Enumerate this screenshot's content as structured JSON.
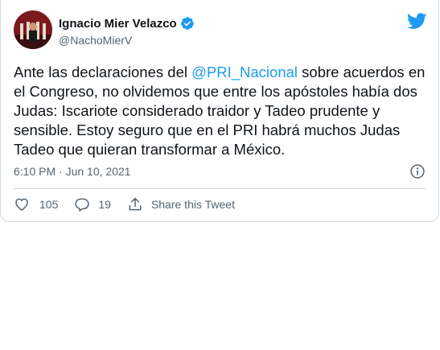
{
  "author": {
    "name": "Ignacio Mier Velazco",
    "handle": "@NachoMierV"
  },
  "tweet": {
    "text_before": "Ante las declaraciones del ",
    "mention": "@PRI_Nacional",
    "text_after": " sobre acuerdos en el Congreso, no olvidemos que entre los apóstoles había dos Judas: Iscariote considerado traidor y Tadeo prudente y sensible. Estoy seguro que en el PRI habrá muchos Judas Tadeo que quieran transformar a México."
  },
  "meta": {
    "timestamp": "6:10 PM · Jun 10, 2021"
  },
  "actions": {
    "likes": "105",
    "replies": "19",
    "share_label": "Share this Tweet"
  },
  "icons": {
    "verified": "verified-badge-icon",
    "brand": "twitter-bird-icon",
    "info": "info-icon",
    "like": "heart-icon",
    "reply": "reply-icon",
    "share": "share-icon"
  },
  "colors": {
    "accent": "#1d9bf0",
    "text": "#0f1419",
    "secondary": "#536471",
    "border": "#cfd9de"
  }
}
